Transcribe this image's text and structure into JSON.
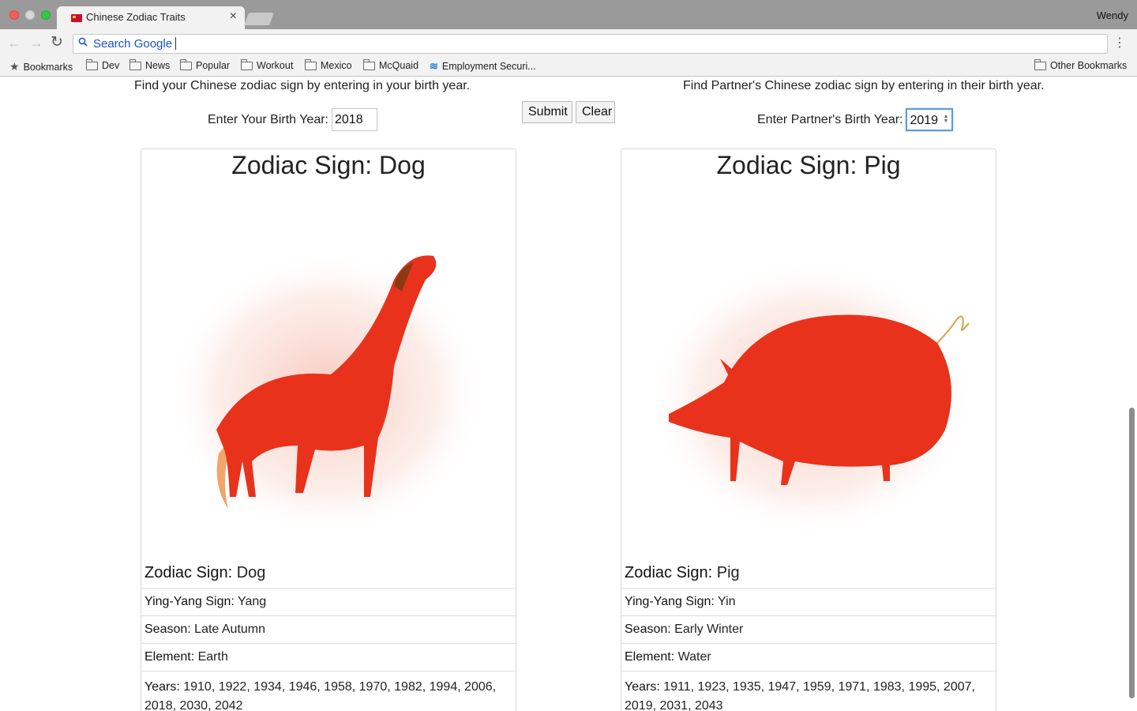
{
  "browser": {
    "tab_title": "Chinese Zodiac Traits",
    "tab_close": "×",
    "profile_name": "Wendy",
    "omnibox_text": "Search Google",
    "bookmarks": [
      "Bookmarks",
      "Dev",
      "News",
      "Popular",
      "Workout",
      "Mexico",
      "McQuaid",
      "Employment Securi..."
    ],
    "other_bookmarks": "Other Bookmarks"
  },
  "form": {
    "intro_self": "Find your Chinese zodiac sign by entering in your birth year.",
    "intro_partner": "Find Partner's Chinese zodiac sign by entering in their birth year.",
    "self_label": "Enter Your Birth Year:",
    "self_value": "2018",
    "partner_label": "Enter Partner's Birth Year:",
    "partner_value": "2019",
    "submit_label": "Submit",
    "clear_label": "Clear"
  },
  "cards": [
    {
      "title": "Zodiac Sign: Dog",
      "sign_label": "Zodiac Sign:",
      "sign_value": "Dog",
      "yy_label": "Ying-Yang Sign:",
      "yy_value": "Yang",
      "season_label": "Season:",
      "season_value": "Late Autumn",
      "element_label": "Element:",
      "element_value": "Earth",
      "years_label": "Years:",
      "years_value": "1910, 1922, 1934, 1946, 1958, 1970, 1982, 1994, 2006, 2018, 2030, 2042",
      "image_icon": "red-dog-illustration"
    },
    {
      "title": "Zodiac Sign: Pig",
      "sign_label": "Zodiac Sign:",
      "sign_value": "Pig",
      "yy_label": "Ying-Yang Sign:",
      "yy_value": "Yin",
      "season_label": "Season:",
      "season_value": "Early Winter",
      "element_label": "Element:",
      "element_value": "Water",
      "years_label": "Years:",
      "years_value": "1911, 1923, 1935, 1947, 1959, 1971, 1983, 1995, 2007, 2019, 2031, 2043",
      "image_icon": "red-pig-illustration"
    }
  ],
  "colors": {
    "illustration_red": "#e8321c",
    "focus_blue": "#5b9dd9",
    "link_blue": "#1a53c8"
  }
}
